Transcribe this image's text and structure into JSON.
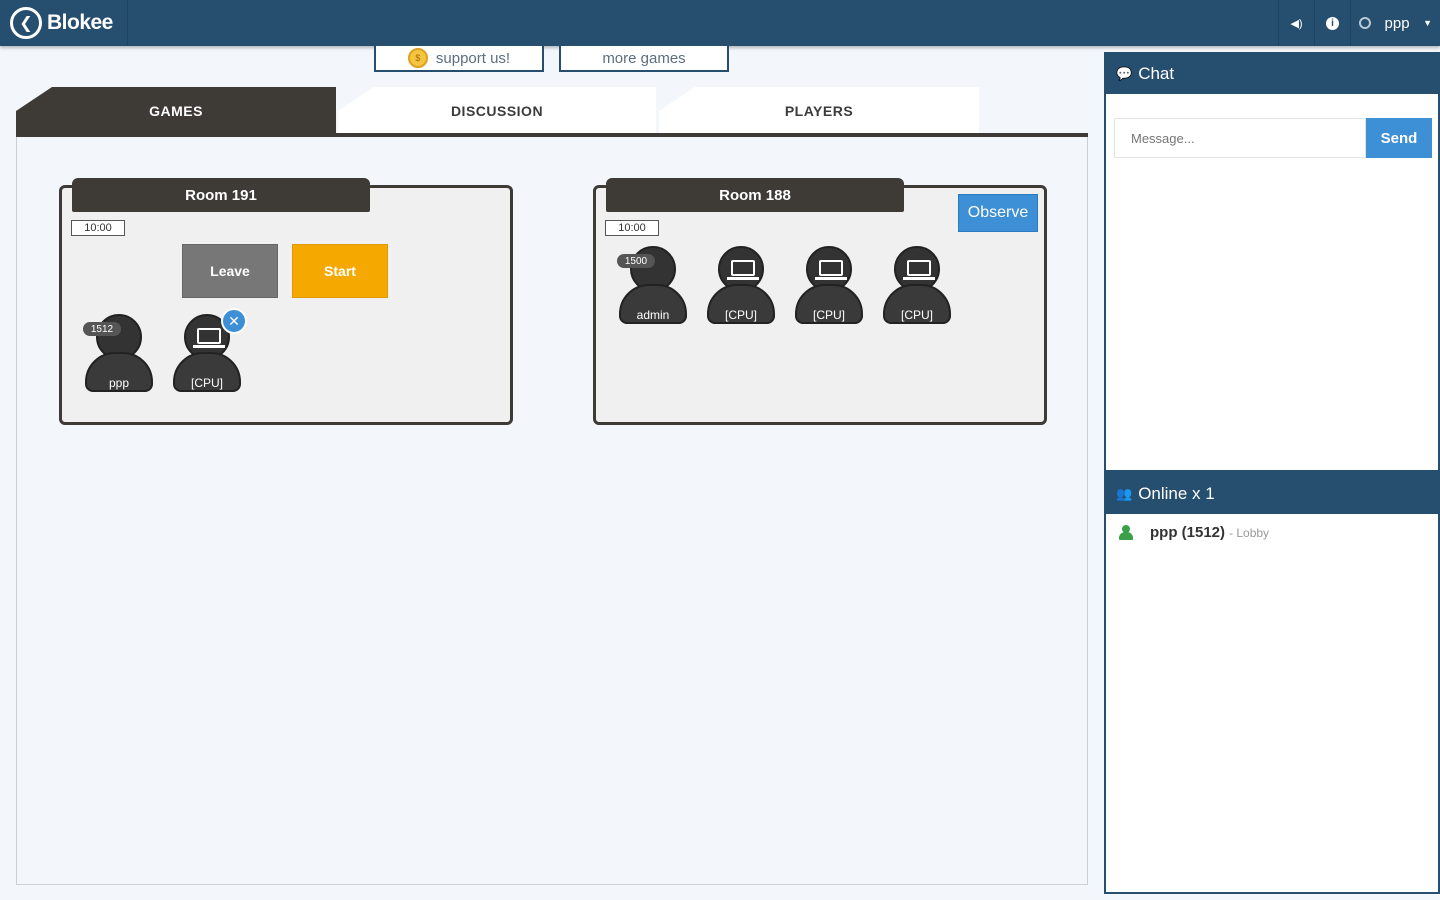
{
  "app": {
    "brand": "Blokee",
    "back_glyph": "❮",
    "user": "ppp",
    "sound_glyph": "◀)",
    "info_glyph": "i",
    "caret_glyph": "▼"
  },
  "promo": {
    "support_label": "support us!",
    "more_label": "more games"
  },
  "tabs": [
    {
      "label": "GAMES",
      "active": true
    },
    {
      "label": "DISCUSSION",
      "active": false
    },
    {
      "label": "PLAYERS",
      "active": false
    }
  ],
  "rooms": [
    {
      "title": "Room 191",
      "time": "10:00",
      "leave_label": "Leave",
      "start_label": "Start",
      "players": [
        {
          "name": "ppp",
          "rating": "1512",
          "cpu": false
        },
        {
          "name": "[CPU]",
          "rating": "",
          "cpu": true,
          "kick": "✕"
        }
      ]
    },
    {
      "title": "Room 188",
      "time": "10:00",
      "observe_label": "Observe",
      "players": [
        {
          "name": "admin",
          "rating": "1500",
          "cpu": false
        },
        {
          "name": "[CPU]",
          "rating": "",
          "cpu": true
        },
        {
          "name": "[CPU]",
          "rating": "",
          "cpu": true
        },
        {
          "name": "[CPU]",
          "rating": "",
          "cpu": true
        }
      ]
    }
  ],
  "chat": {
    "title": "Chat",
    "input_placeholder": "Message...",
    "send_label": "Send",
    "icon_glyph": "💬"
  },
  "online": {
    "title": "Online x 1",
    "icon_glyph": "👥",
    "users": [
      {
        "name": "ppp (1512)",
        "location": "- Lobby"
      }
    ]
  },
  "colors": {
    "topbar": "#264e6f",
    "tab_dark": "#3e3a36",
    "accent_blue": "#3d8fd6",
    "start_orange": "#f5a800",
    "online_green": "#3aa04a"
  }
}
